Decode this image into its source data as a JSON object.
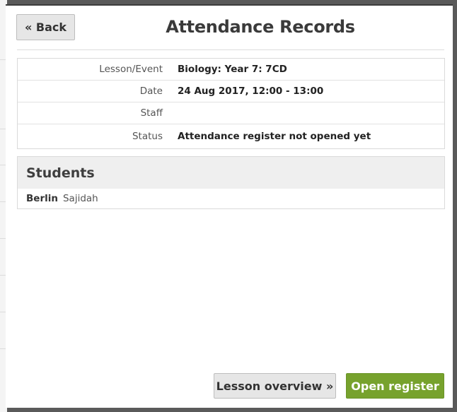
{
  "modal": {
    "back_label": "« Back",
    "title": "Attendance Records"
  },
  "details": [
    {
      "label": "Lesson/Event",
      "value": "Biology: Year 7: 7CD"
    },
    {
      "label": "Date",
      "value": "24 Aug 2017, 12:00 - 13:00"
    },
    {
      "label": "Staff",
      "value": ""
    },
    {
      "label": "Status",
      "value": "Attendance register not opened yet"
    }
  ],
  "students": {
    "heading": "Students",
    "rows": [
      {
        "last_name": "Berlin",
        "first_name": "Sajidah"
      }
    ]
  },
  "footer": {
    "overview_label": "Lesson overview »",
    "open_register_label": "Open register"
  },
  "colors": {
    "primary_button": "#77a22d",
    "secondary_button": "#e6e6e6"
  }
}
